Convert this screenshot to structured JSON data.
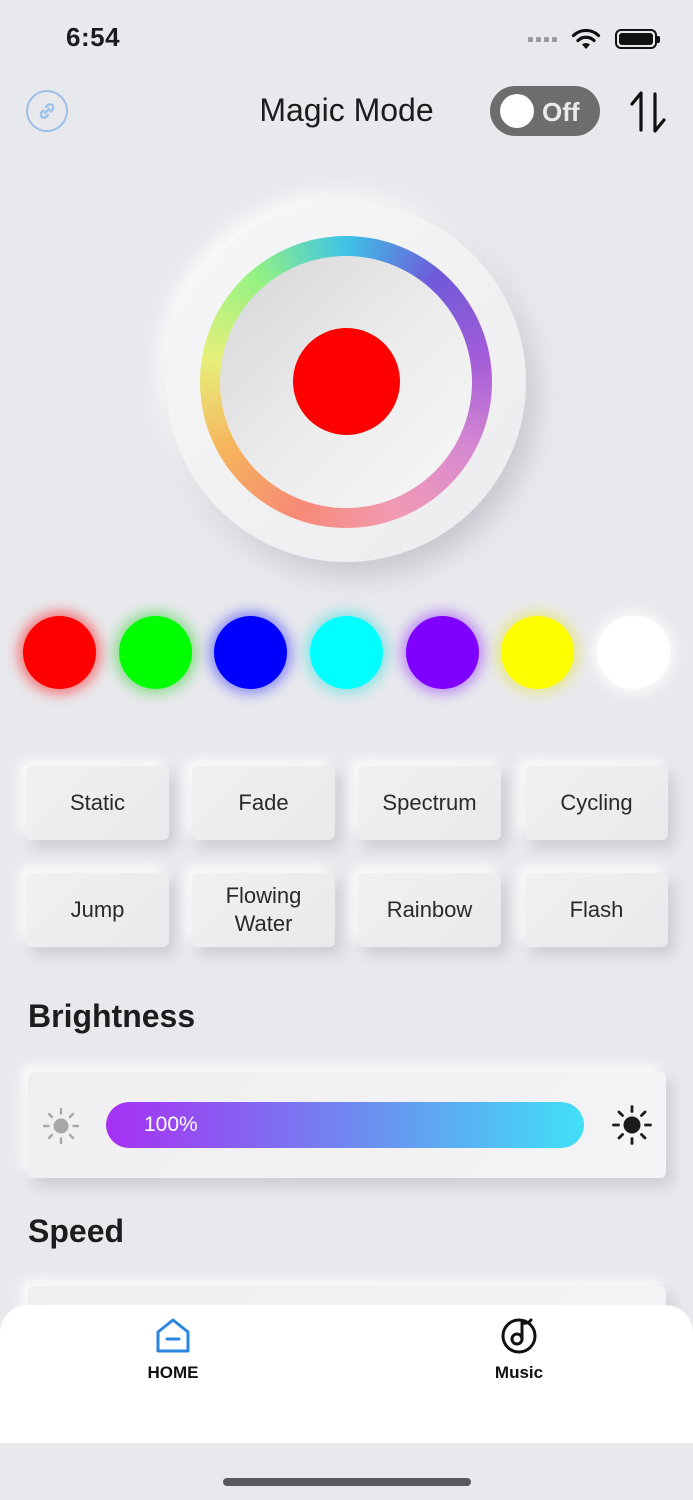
{
  "status_bar": {
    "time": "6:54"
  },
  "header": {
    "title": "Magic Mode",
    "toggle_label": "Off",
    "toggle_on": false,
    "icons": {
      "link": "link-icon",
      "sort": "sort-arrows-icon"
    }
  },
  "color_wheel": {
    "selected_color": "#ff0000"
  },
  "swatches": [
    {
      "color": "#ff0000",
      "glow": "rgba(255,0,0,0.55)"
    },
    {
      "color": "#00ff00",
      "glow": "rgba(0,200,0,0.45)"
    },
    {
      "color": "#0000ff",
      "glow": "rgba(0,0,255,0.45)"
    },
    {
      "color": "#00ffff",
      "glow": "rgba(0,220,220,0.45)"
    },
    {
      "color": "#8000ff",
      "glow": "rgba(128,0,255,0.45)"
    },
    {
      "color": "#ffff00",
      "glow": "rgba(230,230,0,0.45)"
    },
    {
      "color": "#ffffff",
      "glow": "rgba(255,255,255,0.9)"
    }
  ],
  "modes": [
    [
      "Static",
      "Fade",
      "Spectrum",
      "Cycling"
    ],
    [
      "Jump",
      "Flowing Water",
      "Rainbow",
      "Flash"
    ]
  ],
  "brightness": {
    "title": "Brightness",
    "value_label": "100%",
    "value": 1.0
  },
  "speed": {
    "title": "Speed"
  },
  "tabbar": {
    "tabs": [
      {
        "label": "HOME",
        "icon": "home-icon",
        "active": true
      },
      {
        "label": "Music",
        "icon": "music-disc-icon",
        "active": false
      }
    ]
  }
}
